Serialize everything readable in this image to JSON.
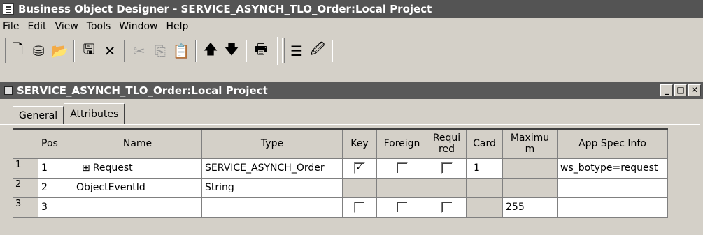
{
  "window": {
    "title": "Business Object Designer - SERVICE_ASYNCH_TLO_Order:Local Project"
  },
  "menu": [
    "File",
    "Edit",
    "View",
    "Tools",
    "Window",
    "Help"
  ],
  "toolbar": {
    "new": "🗋",
    "open_db": "⛁",
    "open": "📂",
    "save": "🖫",
    "delete": "✕",
    "cut": "✂",
    "copy": "⎘",
    "paste": "📋",
    "up": "🡅",
    "down": "🡇",
    "print": "🖶",
    "properties": "☰",
    "attach": "🖉"
  },
  "child": {
    "title": "SERVICE_ASYNCH_TLO_Order:Local Project",
    "minimize": "_",
    "maximize": "□",
    "close": "✕"
  },
  "tabs": [
    "General",
    "Attributes"
  ],
  "columns": [
    "Pos",
    "Name",
    "Type",
    "Key",
    "Foreign",
    "Requi red",
    "Card",
    "Maximu m",
    "App Spec Info"
  ],
  "expand_symbol": "⊞",
  "check_mark": "✓",
  "rows": [
    {
      "num": "1",
      "pos": "1",
      "name": "Request",
      "expandable": true,
      "type": "SERVICE_ASYNCH_Order",
      "key": true,
      "foreign": false,
      "required": false,
      "card": "1",
      "max": "",
      "app": "ws_botype=request"
    },
    {
      "num": "2",
      "pos": "2",
      "name": "ObjectEventId",
      "expandable": false,
      "type": "String",
      "key": null,
      "foreign": null,
      "required": null,
      "card": "",
      "max": "",
      "app": ""
    },
    {
      "num": "3",
      "pos": "3",
      "name": "",
      "expandable": false,
      "type": "",
      "key": false,
      "foreign": false,
      "required": false,
      "card": "",
      "max": "255",
      "app": ""
    }
  ]
}
